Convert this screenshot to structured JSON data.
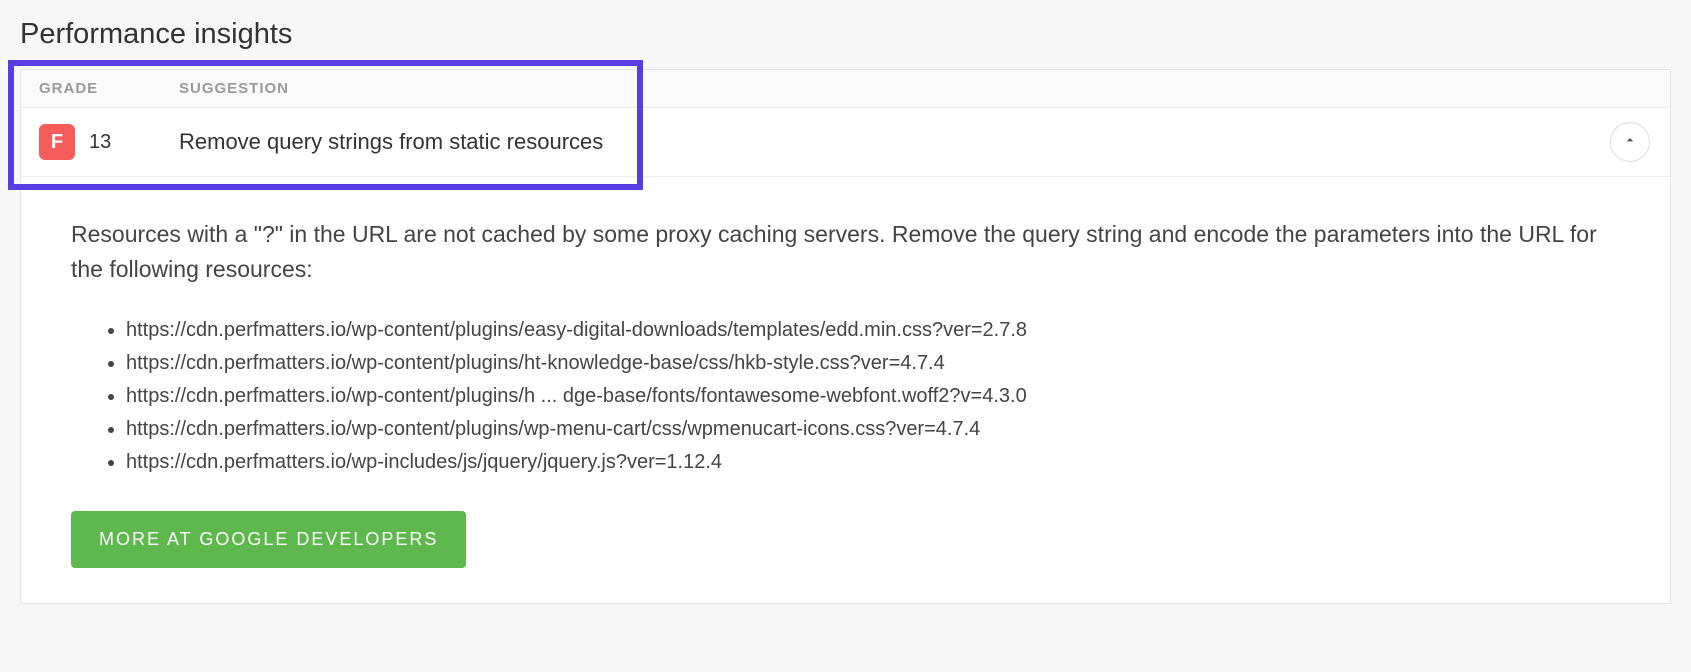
{
  "section_title": "Performance insights",
  "headers": {
    "grade": "GRADE",
    "suggestion": "SUGGESTION"
  },
  "insight": {
    "grade_letter": "F",
    "grade_score": "13",
    "suggestion": "Remove query strings from static resources"
  },
  "body": {
    "description": "Resources with a \"?\" in the URL are not cached by some proxy caching servers. Remove the query string and encode the parameters into the URL for the following resources:",
    "resources": [
      "https://cdn.perfmatters.io/wp-content/plugins/easy-digital-downloads/templates/edd.min.css?ver=2.7.8",
      "https://cdn.perfmatters.io/wp-content/plugins/ht-knowledge-base/css/hkb-style.css?ver=4.7.4",
      "https://cdn.perfmatters.io/wp-content/plugins/h ... dge-base/fonts/fontawesome-webfont.woff2?v=4.3.0",
      "https://cdn.perfmatters.io/wp-content/plugins/wp-menu-cart/css/wpmenucart-icons.css?ver=4.7.4",
      "https://cdn.perfmatters.io/wp-includes/js/jquery/jquery.js?ver=1.12.4"
    ],
    "action_label": "MORE AT GOOGLE DEVELOPERS"
  }
}
